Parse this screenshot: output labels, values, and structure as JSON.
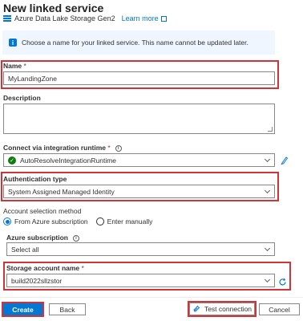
{
  "header": {
    "title": "New linked service",
    "service_name": "Azure Data Lake Storage Gen2",
    "learn_more": "Learn more"
  },
  "info_banner": {
    "text": "Choose a name for your linked service. This name cannot be updated later."
  },
  "name_field": {
    "label": "Name",
    "required_mark": "*",
    "value": "MyLandingZone"
  },
  "description_field": {
    "label": "Description",
    "value": ""
  },
  "integration_runtime": {
    "label": "Connect via integration runtime",
    "required_mark": "*",
    "value": "AutoResolveIntegrationRuntime"
  },
  "authentication": {
    "label": "Authentication type",
    "value": "System Assigned Managed Identity"
  },
  "account_selection": {
    "label": "Account selection method",
    "options": [
      "From Azure subscription",
      "Enter manually"
    ],
    "selected": "From Azure subscription"
  },
  "subscription": {
    "label": "Azure subscription",
    "value": "Select all"
  },
  "storage_account": {
    "label": "Storage account name",
    "required_mark": "*",
    "value": "build2022sllzstor"
  },
  "footer": {
    "create": "Create",
    "back": "Back",
    "test_connection": "Test connection",
    "cancel": "Cancel"
  },
  "colors": {
    "accent": "#0078d4",
    "highlight": "#d13438",
    "success": "#107c10"
  }
}
